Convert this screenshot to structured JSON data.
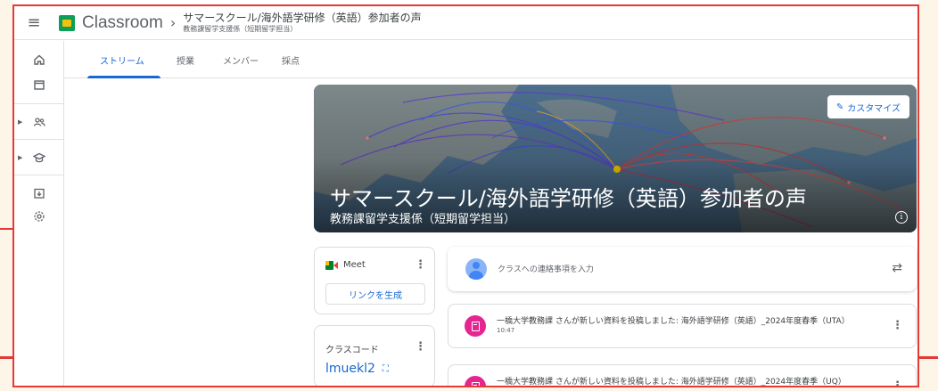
{
  "header": {
    "app_name": "Classroom",
    "breadcrumb_sep": "›",
    "class_title": "サマースクール/海外語学研修（英語）参加者の声",
    "class_subtitle": "教務課留学支援係（短期留学担当）"
  },
  "rail": {
    "items": [
      {
        "icon": "home-icon"
      },
      {
        "icon": "calendar-icon"
      },
      {
        "icon": "people-icon"
      },
      {
        "icon": "school-icon"
      },
      {
        "icon": "archive-icon"
      },
      {
        "icon": "settings-icon"
      }
    ]
  },
  "tabs": [
    {
      "label": "ストリーム",
      "active": true
    },
    {
      "label": "授業",
      "active": false
    },
    {
      "label": "メンバー",
      "active": false
    },
    {
      "label": "採点",
      "active": false
    }
  ],
  "banner": {
    "customize_label": "カスタマイズ",
    "title": "サマースクール/海外語学研修（英語）参加者の声",
    "subtitle": "教務課留学支援係（短期留学担当）",
    "info_glyph": "i"
  },
  "meet": {
    "label": "Meet",
    "generate_link_label": "リンクを生成"
  },
  "class_code": {
    "label": "クラスコード",
    "value": "lmuekl2"
  },
  "composer": {
    "placeholder": "クラスへの連絡事項を入力"
  },
  "feed": [
    {
      "text": "一橋大学教務課 さんが新しい資料を投稿しました: 海外語学研修（英語）_2024年度春季（UTA）",
      "time": "10:47"
    },
    {
      "text": "一橋大学教務課 さんが新しい資料を投稿しました: 海外語学研修（英語）_2024年度春季（UQ）",
      "time": ""
    }
  ],
  "colors": {
    "accent": "#1967d2",
    "frame_red": "#e53935",
    "feed_icon": "#e52592",
    "banner_bg": "#5a7a96"
  }
}
